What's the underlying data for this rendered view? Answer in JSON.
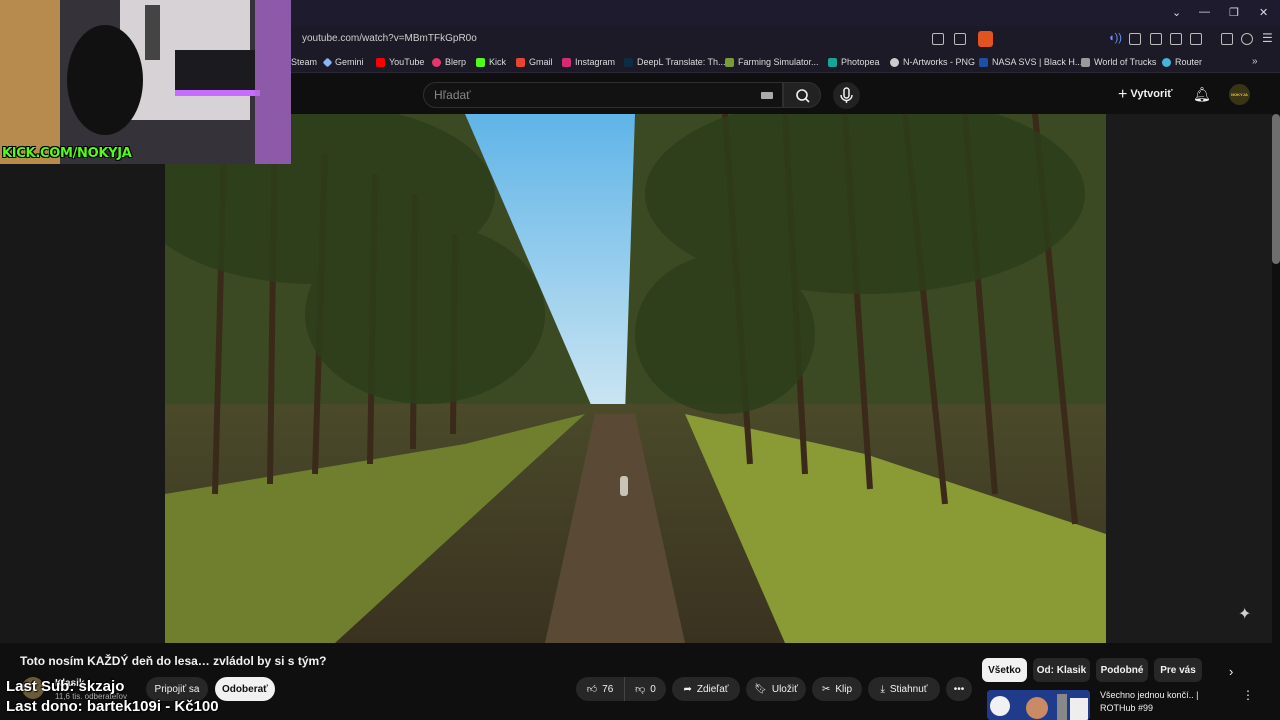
{
  "browser": {
    "url": "youtube.com/watch?v=MBmTFkGpR0o",
    "bookmarks": [
      "Steam",
      "Gemini",
      "YouTube",
      "Blerp",
      "Kick",
      "Gmail",
      "Instagram",
      "DeepL Translate: Th...",
      "Farming Simulator...",
      "Photopea",
      "N-Artworks - PNG",
      "NASA SVS | Black H...",
      "World of Trucks",
      "Router"
    ]
  },
  "header": {
    "search_placeholder": "Hľadať",
    "create_label": "Vytvoriť",
    "avatar_text": "NOKYJA"
  },
  "webcam": {
    "kick_label": "KICK.COM/NOKYJA"
  },
  "video": {
    "title": "Toto nosím KAŽDÝ deň do lesa… zvládol by si s tým?"
  },
  "channel": {
    "name": "Klasik",
    "subscribers": "11,6 tis. odberateľov",
    "join_label": "Pripojiť sa",
    "subscribe_label": "Odoberať"
  },
  "actions": {
    "likes": "76",
    "dislikes": "0",
    "share": "Zdieľať",
    "save": "Uložiť",
    "clip": "Klip",
    "download": "Stiahnuť"
  },
  "chips": [
    "Všetko",
    "Od: Klasik",
    "Podobné",
    "Pre vás"
  ],
  "recommended": {
    "title": "Všechno jednou končí.. | ROTHub #99"
  },
  "overlay": {
    "last_sub": "Last Sub: skzajo",
    "last_dono": "Last dono: bartek109i - Kč100"
  }
}
